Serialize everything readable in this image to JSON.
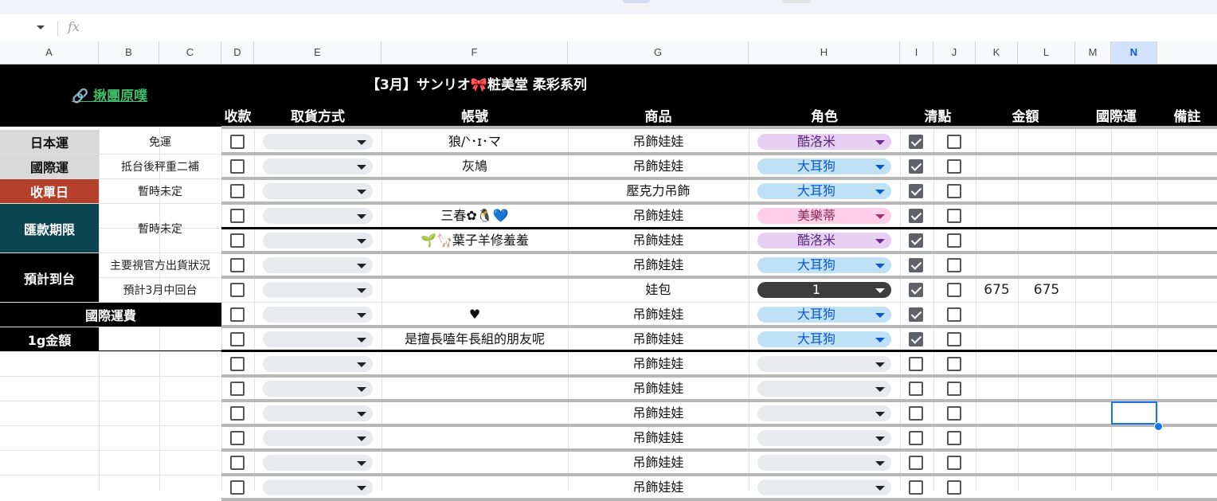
{
  "columns": [
    "A",
    "B",
    "C",
    "D",
    "E",
    "F",
    "G",
    "H",
    "I",
    "J",
    "K",
    "L",
    "M",
    "N"
  ],
  "selected_column": "N",
  "formula_bar": {
    "fx": "fx"
  },
  "sheet": {
    "link_text": "🔗 揪團原噗",
    "title": "【3月】サンリオ🎀粧美堂 柔彩系列",
    "headers": {
      "payment": "收款",
      "pickup": "取貨方式",
      "account": "帳號",
      "product": "商品",
      "character": "角色",
      "checklist": "清點",
      "amount": "金額",
      "intl_shipping": "國際運",
      "notes": "備註"
    }
  },
  "info": {
    "japan_shipping": {
      "label": "日本運",
      "value": "免運"
    },
    "intl_shipping": {
      "label": "國際運",
      "value": "抵台後秤重二補"
    },
    "order_close": {
      "label": "收單日",
      "value": "暫時未定"
    },
    "payment_deadline": {
      "label": "匯款期限",
      "value": "暫時未定"
    },
    "eta": {
      "label": "預計到台",
      "value1": "主要視官方出貨狀況",
      "value2": "預計3月中回台"
    },
    "intl_fee": {
      "label": "國際運費"
    },
    "per_gram": {
      "label": "1g金額"
    }
  },
  "colors": {
    "purple_pill": "#e6cff2",
    "blue_pill": "#bfe1f6",
    "pink_pill": "#ffcfe9",
    "dark_pill": "#3d3d3d",
    "order_close_bg": "#b5412a",
    "deadline_bg": "#0b4650",
    "link": "#3dbd6a"
  },
  "rows": [
    {
      "account": "狼/ᐠ･ɪ･マ",
      "product": "吊飾娃娃",
      "character": "酷洛米",
      "pill": "purple",
      "checked": true
    },
    {
      "account": "灰鳩",
      "product": "吊飾娃娃",
      "character": "大耳狗",
      "pill": "blue",
      "checked": true
    },
    {
      "account": "",
      "product": "壓克力吊飾",
      "character": "大耳狗",
      "pill": "blue",
      "checked": true
    },
    {
      "account": "三春✿🐧💙",
      "product": "吊飾娃娃",
      "character": "美樂蒂",
      "pill": "pink",
      "checked": true
    },
    {
      "account": "🌱🦙葉子羊修羞羞",
      "product": "吊飾娃娃",
      "character": "酷洛米",
      "pill": "purple",
      "checked": true
    },
    {
      "account": "",
      "product": "吊飾娃娃",
      "character": "大耳狗",
      "pill": "blue",
      "checked": true
    },
    {
      "account": "",
      "product": "娃包",
      "character": "1",
      "pill": "dark",
      "checked": true,
      "k": "675",
      "l": "675"
    },
    {
      "account": "♥",
      "product": "吊飾娃娃",
      "character": "大耳狗",
      "pill": "blue",
      "checked": true
    },
    {
      "account": "是擅長嗑年長組的朋友呢",
      "product": "吊飾娃娃",
      "character": "大耳狗",
      "pill": "blue",
      "checked": true
    },
    {
      "account": "",
      "product": "吊飾娃娃",
      "character": "",
      "pill": "grey",
      "checked": false
    },
    {
      "account": "",
      "product": "吊飾娃娃",
      "character": "",
      "pill": "grey",
      "checked": false
    },
    {
      "account": "",
      "product": "吊飾娃娃",
      "character": "",
      "pill": "grey",
      "checked": false
    },
    {
      "account": "",
      "product": "吊飾娃娃",
      "character": "",
      "pill": "grey",
      "checked": false
    },
    {
      "account": "",
      "product": "吊飾娃娃",
      "character": "",
      "pill": "grey",
      "checked": false
    },
    {
      "account": "",
      "product": "吊飾娃娃",
      "character": "",
      "pill": "grey",
      "checked": false
    }
  ]
}
